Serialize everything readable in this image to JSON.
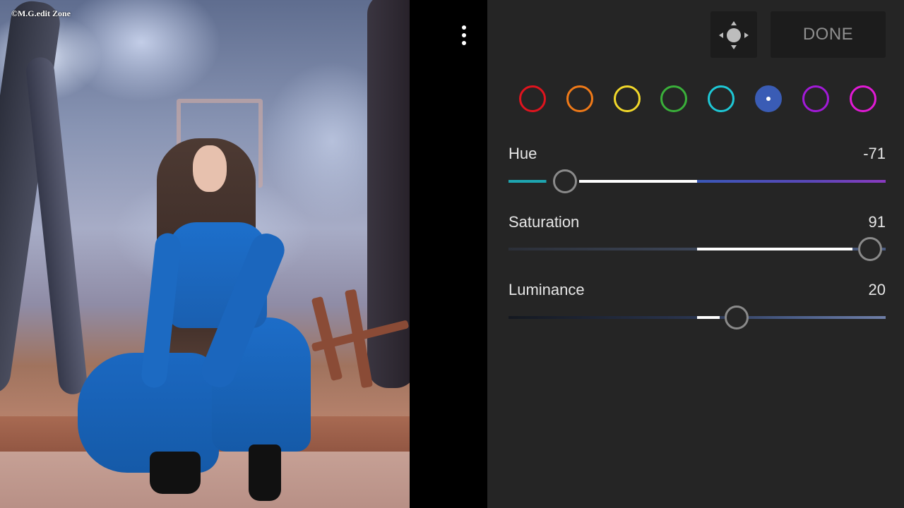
{
  "photo": {
    "watermark": "©M.G.edit Zone"
  },
  "toolbar": {
    "more_icon": "more-vertical-icon",
    "target_icon": "target-adjust-icon",
    "done_label": "DONE"
  },
  "color_swatches": [
    {
      "name": "red",
      "color": "#e0141e",
      "selected": false
    },
    {
      "name": "orange",
      "color": "#f07a18",
      "selected": false
    },
    {
      "name": "yellow",
      "color": "#f2d82a",
      "selected": false
    },
    {
      "name": "green",
      "color": "#3ab03a",
      "selected": false
    },
    {
      "name": "aqua",
      "color": "#1ec8d6",
      "selected": false
    },
    {
      "name": "blue",
      "color": "#3a5cb5",
      "selected": true
    },
    {
      "name": "purple",
      "color": "#a21ad8",
      "selected": false
    },
    {
      "name": "magenta",
      "color": "#e21ad6",
      "selected": false
    }
  ],
  "sliders": {
    "hue": {
      "label": "Hue",
      "value": "-71"
    },
    "saturation": {
      "label": "Saturation",
      "value": "91"
    },
    "luminance": {
      "label": "Luminance",
      "value": "20"
    }
  }
}
